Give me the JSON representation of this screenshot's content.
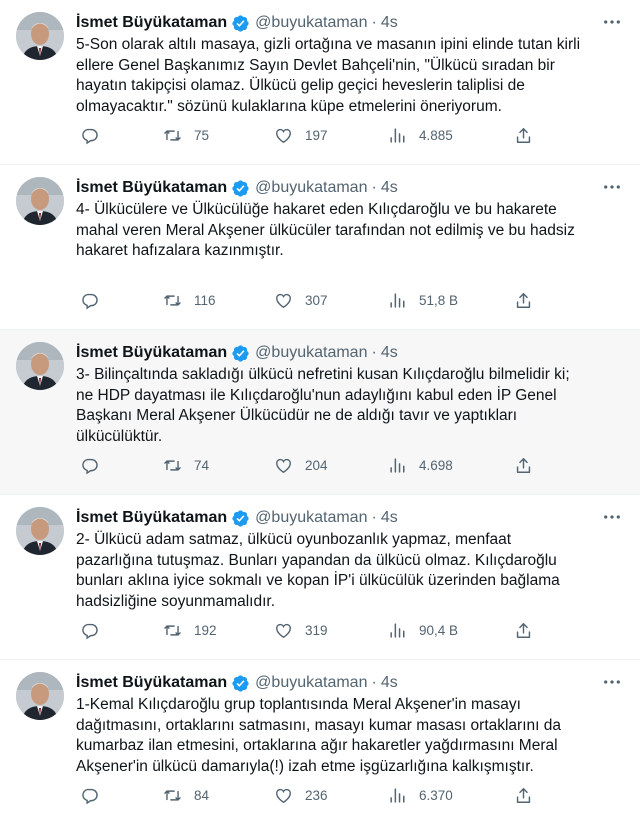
{
  "author": {
    "name": "İsmet Büyükataman",
    "handle": "@buyukataman",
    "separator": "·",
    "verified": true,
    "badge_color": "#1d9bf0"
  },
  "icons": {
    "reply": "reply-icon",
    "retweet": "retweet-icon",
    "like": "heart-icon",
    "views": "views-icon",
    "share": "share-icon",
    "more": "more-icon"
  },
  "tweets": [
    {
      "time": "4s",
      "lines": [
        "5-Son olarak altılı masaya, gizli ortağına ve masanın ipini elinde tutan kirli",
        "ellere Genel Başkanımız Sayın Devlet Bahçeli'nin, \"Ülkücü sıradan bir",
        "hayatın takipçisi olamaz. Ülkücü gelip geçici heveslerin taliplisi de",
        "olmayacaktır.\" sözünü kulaklarına küpe etmelerini öneriyorum."
      ],
      "retweets": "75",
      "likes": "197",
      "views": "4.885"
    },
    {
      "time": "4s",
      "lines": [
        "4- Ülkücülere ve Ülkücülüğe hakaret eden Kılıçdaroğlu ve bu hakarete",
        "mahal veren Meral Akşener  ülkücüler tarafından not edilmiş ve bu hadsiz",
        "hakaret hafızalara kazınmıştır."
      ],
      "retweets": "116",
      "likes": "307",
      "views": "51,8 B"
    },
    {
      "time": "4s",
      "lines": [
        "3- Bilinçaltında sakladığı ülkücü nefretini kusan Kılıçdaroğlu bilmelidir ki;",
        "ne HDP dayatması ile Kılıçdaroğlu'nun adaylığını kabul eden İP Genel",
        "Başkanı Meral Akşener Ülkücüdür ne de aldığı tavır ve yaptıkları",
        "ülkücülüktür."
      ],
      "retweets": "74",
      "likes": "204",
      "views": "4.698"
    },
    {
      "time": "4s",
      "lines": [
        "2- Ülkücü adam satmaz, ülkücü oyunbozanlık yapmaz, menfaat",
        "pazarlığına tutuşmaz. Bunları yapandan da ülkücü olmaz. Kılıçdaroğlu",
        "bunları aklına iyice sokmalı ve kopan İP'i ülkücülük üzerinden bağlama",
        "hadsizliğine soyunmamalıdır."
      ],
      "retweets": "192",
      "likes": "319",
      "views": "90,4 B"
    },
    {
      "time": "4s",
      "lines": [
        "1-Kemal Kılıçdaroğlu grup toplantısında Meral Akşener'in masayı",
        "dağıtmasını, ortaklarını satmasını, masayı kumar masası ortaklarını da",
        "kumarbaz ilan etmesini, ortaklarına ağır hakaretler yağdırmasını Meral",
        "Akşener'in ülkücü damarıyla(!) izah etme işgüzarlığına kalkışmıştır."
      ],
      "retweets": "84",
      "likes": "236",
      "views": "6.370"
    }
  ]
}
